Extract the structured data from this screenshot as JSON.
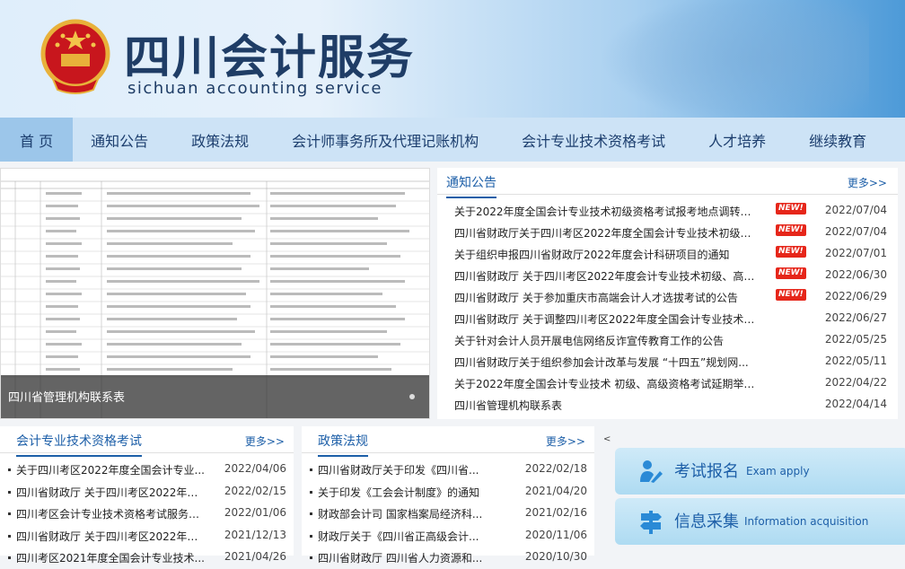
{
  "header": {
    "title": "四川会计服务",
    "subtitle": "sichuan accounting service"
  },
  "nav": {
    "items": [
      {
        "label": "首 页",
        "active": true
      },
      {
        "label": "通知公告",
        "active": false
      },
      {
        "label": "政策法规",
        "active": false
      },
      {
        "label": "会计师事务所及代理记账机构",
        "active": false
      },
      {
        "label": "会计专业技术资格考试",
        "active": false
      },
      {
        "label": "人才培养",
        "active": false
      },
      {
        "label": "继续教育",
        "active": false
      }
    ]
  },
  "slide": {
    "caption": "四川省管理机构联系表"
  },
  "notice": {
    "title": "通知公告",
    "more": "更多>>",
    "new_badge": "NEW!",
    "items": [
      {
        "title": "关于2022年度全国会计专业技术初级资格考试报考地点调转及...",
        "date": "2022/07/04",
        "new": true
      },
      {
        "title": "四川省财政厅关于四川考区2022年度全国会计专业技术初级资...",
        "date": "2022/07/04",
        "new": true
      },
      {
        "title": "关于组织申报四川省财政厅2022年度会计科研项目的通知",
        "date": "2022/07/01",
        "new": true
      },
      {
        "title": "四川省财政厅 关于四川考区2022年度会计专业技术初级、高级...",
        "date": "2022/06/30",
        "new": true
      },
      {
        "title": "四川省财政厅 关于参加重庆市高端会计人才选拔考试的公告",
        "date": "2022/06/29",
        "new": true
      },
      {
        "title": "四川省财政厅 关于调整四川考区2022年度全国会计专业技术初...",
        "date": "2022/06/27",
        "new": false
      },
      {
        "title": "关于针对会计人员开展电信网络反诈宣传教育工作的公告",
        "date": "2022/05/25",
        "new": false
      },
      {
        "title": "四川省财政厅关于组织参加会计改革与发展 “十四五”规划网...",
        "date": "2022/05/11",
        "new": false
      },
      {
        "title": "关于2022年度全国会计专业技术 初级、高级资格考试延期举行...",
        "date": "2022/04/22",
        "new": false
      },
      {
        "title": "四川省管理机构联系表",
        "date": "2022/04/14",
        "new": false
      }
    ]
  },
  "exam": {
    "title": "会计专业技术资格考试",
    "more": "更多>>",
    "items": [
      {
        "title": "关于四川考区2022年度全国会计专业...",
        "date": "2022/04/06"
      },
      {
        "title": "四川省财政厅 关于四川考区2022年度...",
        "date": "2022/02/15"
      },
      {
        "title": "四川考区会计专业技术资格考试服务事...",
        "date": "2022/01/06"
      },
      {
        "title": "四川省财政厅 关于四川考区2022年度...",
        "date": "2021/12/13"
      },
      {
        "title": "四川考区2021年度全国会计专业技术...",
        "date": "2021/04/26"
      }
    ]
  },
  "policy": {
    "title": "政策法规",
    "more": "更多>>",
    "items": [
      {
        "title": "四川省财政厅关于印发《四川省...",
        "date": "2022/02/18"
      },
      {
        "title": "关于印发《工会会计制度》的通知",
        "date": "2021/04/20"
      },
      {
        "title": "财政部会计司 国家档案局经济科...",
        "date": "2021/02/16"
      },
      {
        "title": "财政厅关于《四川省正高级会计...",
        "date": "2020/11/06"
      },
      {
        "title": "四川省财政厅 四川省人力资源和...",
        "date": "2020/10/30"
      }
    ]
  },
  "arrow_mark": "<",
  "services": [
    {
      "zh": "考试报名",
      "en": "Exam apply",
      "icon": "person-register-icon"
    },
    {
      "zh": "信息采集",
      "en": "Information acquisition",
      "icon": "signpost-icon"
    }
  ]
}
